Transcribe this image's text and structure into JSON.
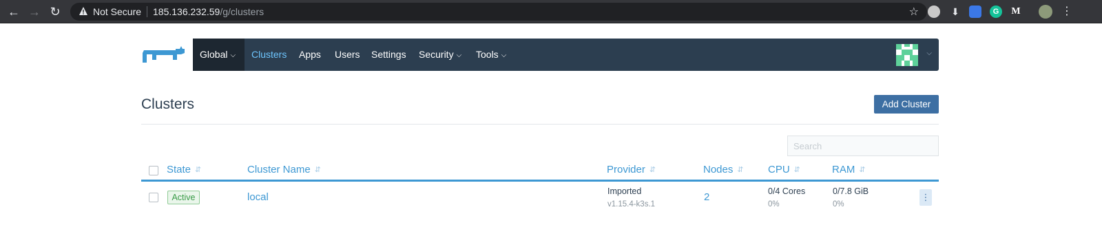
{
  "browser": {
    "security_label": "Not Secure",
    "url_host": "185.136.232.59",
    "url_path": "/g/clusters"
  },
  "header": {
    "global_label": "Global",
    "nav": [
      {
        "label": "Clusters",
        "active": true
      },
      {
        "label": "Apps"
      },
      {
        "label": "Users"
      },
      {
        "label": "Settings"
      },
      {
        "label": "Security",
        "dropdown": true
      },
      {
        "label": "Tools",
        "dropdown": true
      }
    ]
  },
  "page": {
    "title": "Clusters",
    "add_button": "Add Cluster",
    "search_placeholder": "Search"
  },
  "table": {
    "columns": [
      "State",
      "Cluster Name",
      "Provider",
      "Nodes",
      "CPU",
      "RAM"
    ],
    "rows": [
      {
        "state": "Active",
        "name": "local",
        "provider": "Imported",
        "provider_version": "v1.15.4-k3s.1",
        "nodes": "2",
        "cpu": "0/4 Cores",
        "cpu_pct": "0%",
        "ram": "0/7.8 GiB",
        "ram_pct": "0%"
      }
    ]
  },
  "colors": {
    "navbar": "#2c3e50",
    "accent": "#3d98d3",
    "button": "#3d6fa3",
    "active_badge": "#3a9b48"
  }
}
